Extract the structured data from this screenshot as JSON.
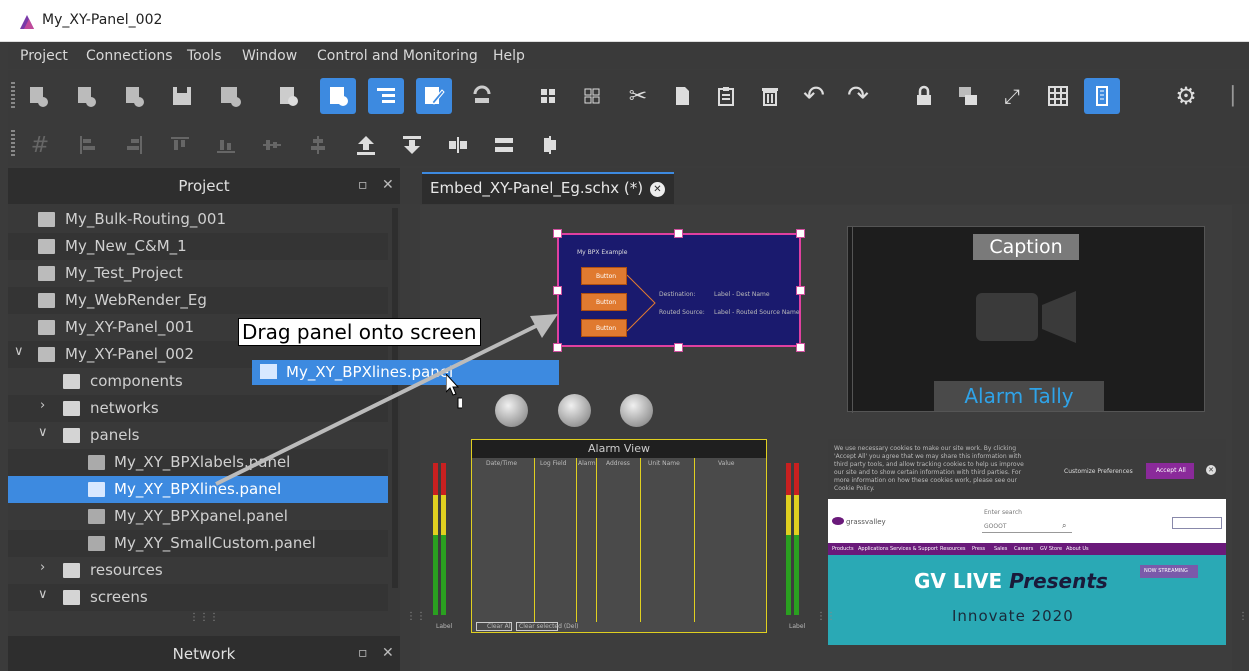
{
  "window": {
    "title": "My_XY-Panel_002"
  },
  "menu": [
    "Project",
    "Connections",
    "Tools",
    "Window",
    "Control and Monitoring",
    "Help"
  ],
  "project_panel": {
    "title": "Project",
    "items": [
      "My_Bulk-Routing_001",
      "My_New_C&M_1",
      "My_Test_Project",
      "My_WebRender_Eg",
      "My_XY-Panel_001",
      "My_XY-Panel_002",
      "components",
      "networks",
      "panels",
      "My_XY_BPXlabels.panel",
      "My_XY_BPXlines.panel",
      "My_XY_BPXpanel.panel",
      "My_XY_SmallCustom.panel",
      "resources",
      "screens"
    ]
  },
  "network_panel": {
    "title": "Network"
  },
  "editor_tab": {
    "label": "Embed_XY-Panel_Eg.schx (*)"
  },
  "drag": {
    "callout": "Drag panel onto screen",
    "ghost_label": "My_XY_BPXlines.panel"
  },
  "bpx_panel": {
    "title": "My BPX Example",
    "buttons": [
      "Button",
      "Button",
      "Button"
    ],
    "destination_label": "Destination:",
    "destination_value": "Label - Dest Name",
    "routed_label": "Routed Source:",
    "routed_value": "Label - Routed Source Name"
  },
  "video_widget": {
    "caption": "Caption",
    "alarm_tally": "Alarm Tally"
  },
  "alarm_view": {
    "title": "Alarm View",
    "columns": [
      "Date/Time",
      "Log Field",
      "Alarm",
      "Address",
      "Unit Name",
      "Value"
    ],
    "buttons": [
      "Clear All",
      "Clear selected (Del)"
    ],
    "meter_label_left": "Label",
    "meter_label_right": "Label"
  },
  "web_widget": {
    "cookie_text": "We use necessary cookies to make our site work. By clicking 'Accept All' you agree that we may share this information with third party tools, and allow tracking cookies to help us improve our site and to show certain information with third parties. For more information on how these cookies work, please see our Cookie Policy.",
    "customize": "Customize Preferences",
    "accept": "Accept All",
    "logo": "grassvalley",
    "search_hint": "Enter search",
    "search_value": "GOOOT",
    "nav": [
      "Products",
      "Applications",
      "Services & Support",
      "Resources",
      "Press",
      "Sales",
      "Careers",
      "GV Store",
      "About Us"
    ],
    "hero_title": "GV LIVE",
    "hero_italic": "Presents",
    "hero_sub": "Innovate 2020",
    "hero_btn": "NOW STREAMING"
  },
  "colors": {
    "accent": "#3d8ae0",
    "selection_border": "#e040a0",
    "bpx_bg": "#1a1a6e",
    "bpx_button": "#e07a30",
    "web_nav": "#6a1a7a",
    "hero": "#2aa9b5",
    "alarm_blue": "#2fa3e8"
  }
}
